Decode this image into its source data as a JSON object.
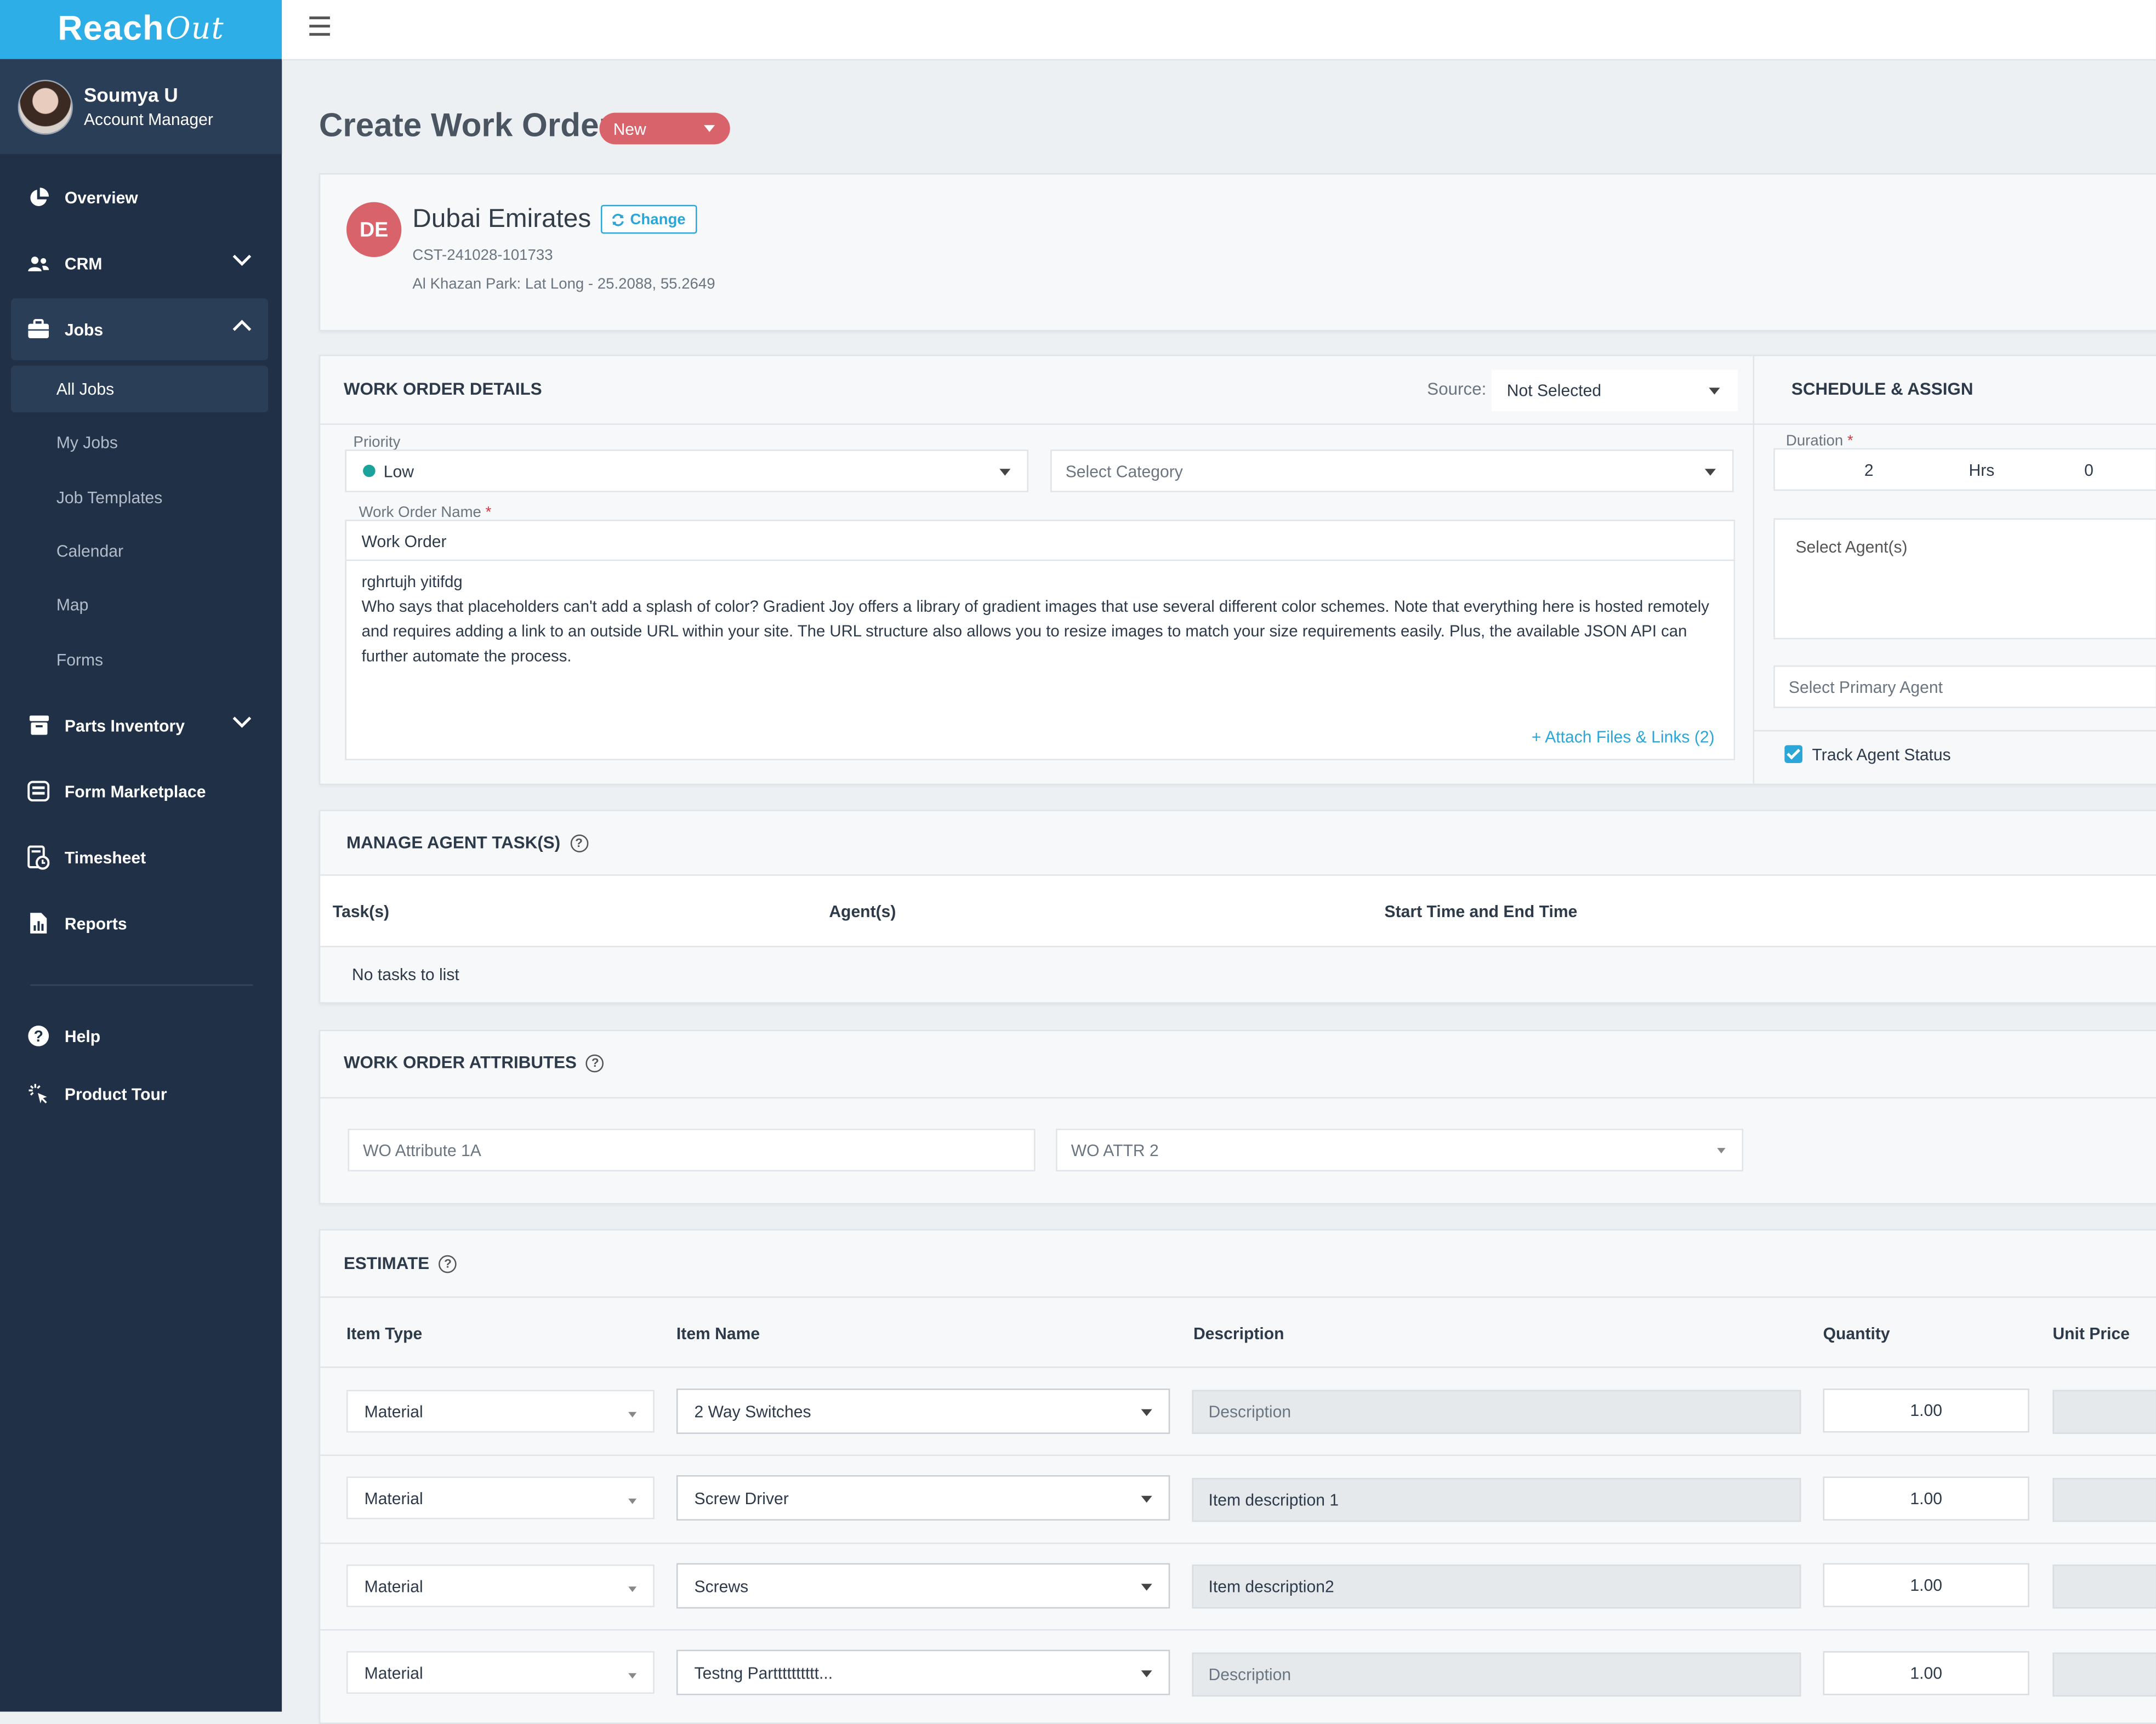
{
  "sidebar": {
    "logo_main": "Reach",
    "logo_accent": "Out",
    "user": {
      "name": "Soumya U",
      "role": "Account Manager"
    },
    "items": [
      {
        "label": "Overview",
        "icon": "pie-chart-icon"
      },
      {
        "label": "CRM",
        "icon": "users-icon",
        "chevron": "down"
      },
      {
        "label": "Jobs",
        "icon": "briefcase-icon",
        "chevron": "up",
        "active": true
      },
      {
        "label": "Parts Inventory",
        "icon": "archive-icon",
        "chevron": "down"
      },
      {
        "label": "Form Marketplace",
        "icon": "form-icon"
      },
      {
        "label": "Timesheet",
        "icon": "timesheet-icon"
      },
      {
        "label": "Reports",
        "icon": "reports-icon"
      }
    ],
    "jobs_sub": [
      "All Jobs",
      "My Jobs",
      "Job Templates",
      "Calendar",
      "Map",
      "Forms"
    ],
    "bottom": [
      {
        "label": "Help",
        "icon": "help-circle-icon"
      },
      {
        "label": "Product Tour",
        "icon": "product-tour-icon"
      }
    ]
  },
  "page": {
    "title": "Create Work Order",
    "status": "New"
  },
  "customer": {
    "initials": "DE",
    "name": "Dubai Emirates",
    "change_label": "Change",
    "id": "CST-241028-101733",
    "location": "Al Khazan Park: Lat Long - 25.2088, 55.2649"
  },
  "work_order": {
    "section_title": "WORK ORDER DETAILS",
    "source_label": "Source:",
    "source_value": "Not Selected",
    "priority_label": "Priority",
    "priority_value": "Low",
    "priority_color": "#1aa39a",
    "category_placeholder": "Select Category",
    "name_label": "Work Order Name",
    "required_mark": "*",
    "name_value": "Work Order",
    "description_line1": "rghrtujh yitifdg",
    "description_line2": "Who says that placeholders can't add a splash of color? Gradient Joy offers a library of gradient images that use several different color schemes. Note that everything here is hosted remotely and requires adding a link to an outside URL within your site. The URL structure also allows you to resize images to match your size requirements easily. Plus, the available JSON API can further automate the process.",
    "attach_label": "+ Attach Files & Links (2)"
  },
  "schedule": {
    "section_title": "SCHEDULE & ASSIGN",
    "duration_label": "Duration",
    "duration_hours": "2",
    "duration_unit": "Hrs",
    "duration_minutes": "0",
    "agents_placeholder": "Select Agent(s)",
    "primary_agent_placeholder": "Select Primary Agent",
    "track_status_label": "Track Agent Status",
    "track_status_checked": true
  },
  "tasks": {
    "section_title": "MANAGE AGENT TASK(S)",
    "columns": [
      "Task(s)",
      "Agent(s)",
      "Start Time and End Time"
    ],
    "empty_text": "No tasks to list"
  },
  "attributes": {
    "section_title": "WORK ORDER ATTRIBUTES",
    "attr1_placeholder": "WO Attribute 1A",
    "attr2_placeholder": "WO ATTR 2"
  },
  "estimate": {
    "section_title": "ESTIMATE",
    "columns": [
      "Item Type",
      "Item Name",
      "Description",
      "Quantity",
      "Unit Price"
    ],
    "rows": [
      {
        "type": "Material",
        "name": "2 Way Switches",
        "description": "Description",
        "description_is_placeholder": true,
        "quantity": "1.00"
      },
      {
        "type": "Material",
        "name": "Screw Driver",
        "description": "Item description 1",
        "description_is_placeholder": false,
        "quantity": "1.00"
      },
      {
        "type": "Material",
        "name": "Screws",
        "description": "Item description2",
        "description_is_placeholder": false,
        "quantity": "1.00"
      },
      {
        "type": "Material",
        "name": "Testng Partttttttttt...",
        "description": "Description",
        "description_is_placeholder": true,
        "quantity": "1.00"
      }
    ]
  },
  "colors": {
    "sidebar_bg": "#1f3047",
    "logo_bar": "#2eaee6",
    "accent": "#2aa7d8",
    "status_pill": "#d9636a",
    "customer_avatar": "#d9636a"
  }
}
